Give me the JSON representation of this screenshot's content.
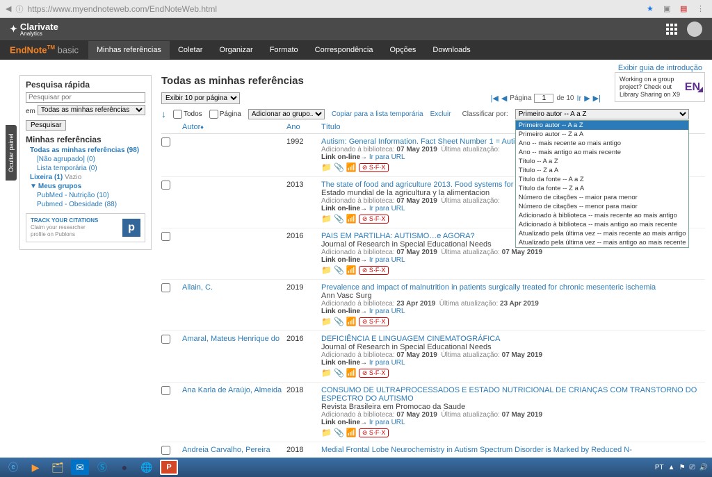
{
  "url": "https://www.myendnoteweb.com/EndNoteWeb.html",
  "clarivate": {
    "name": "Clarivate",
    "sub": "Analytics"
  },
  "brand": {
    "name": "EndNote",
    "tm": "TM",
    "variant": "basic"
  },
  "nav": {
    "items": [
      "Minhas referências",
      "Coletar",
      "Organizar",
      "Formato",
      "Correspondência",
      "Opções",
      "Downloads"
    ],
    "active": 0
  },
  "intro_link": "Exibir guia de introdução",
  "hide_panel": "Ocultar painel",
  "sidebar": {
    "quick_search": {
      "title": "Pesquisa rápida",
      "placeholder": "Pesquisar por",
      "in_label": "em",
      "scope": "Todas as minhas referências",
      "button": "Pesquisar"
    },
    "refs_title": "Minhas referências",
    "all_refs": "Todas as minhas referências (98)",
    "unfiled": "[Não agrupado] (0)",
    "temp": "Lista temporária (0)",
    "trash_label": "Lixeira (1)",
    "trash_empty": "Vazio",
    "groups_title": "Meus grupos",
    "groups": [
      "PubMed - Nutrição  (10)",
      "Pubmed - Obesidade  (88)"
    ],
    "track": {
      "title": "TRACK YOUR CITATIONS",
      "line1": "Claim your researcher",
      "line2": "profile on Publons"
    }
  },
  "content": {
    "title": "Todas as minhas referências",
    "per_page": "Exibir 10 por página",
    "pager": {
      "label": "Página",
      "current": "1",
      "of": "de 10",
      "go": "Ir"
    },
    "promo": "Working on a group project? Check out Library Sharing on X9",
    "promo_badge": "EN",
    "actions": {
      "all": "Todos",
      "page": "Página",
      "add_group": "Adicionar ao grupo...",
      "copy_temp": "Copiar para a lista temporária",
      "delete": "Excluir",
      "sort_label": "Classificar por:",
      "sort_selected": "Primeiro autor -- A a Z"
    },
    "sort_options": [
      "Primeiro autor -- A a Z",
      "Primeiro autor -- Z a A",
      "Ano -- mais recente ao mais antigo",
      "Ano -- mais antigo ao mais recente",
      "Título -- A a Z",
      "Título -- Z a A",
      "Título da fonte -- A a Z",
      "Título da fonte -- Z a A",
      "Número de citações -- maior para menor",
      "Número de citações -- menor para maior",
      "Adicionado à biblioteca -- mais recente ao mais antigo",
      "Adicionado à biblioteca -- mais antigo ao mais recente",
      "Atualizado pela última vez -- mais recente ao mais antigo",
      "Atualizado pela última vez -- mais antigo ao mais recente"
    ],
    "columns": {
      "author": "Autor",
      "year": "Ano",
      "title": "Título"
    },
    "meta_labels": {
      "added": "Adicionado à biblioteca:",
      "updated": "Última atualização:",
      "link": "Link on-line",
      "go_url": "Ir para URL",
      "sfx": "S·F·X"
    },
    "rows": [
      {
        "author": "",
        "year": "1992",
        "title": "Autism: General Information. Fact Sheet Number 1 = Autismo: Informacion General. Numero 22",
        "journal": "",
        "added": "07 May 2019",
        "updated": ""
      },
      {
        "author": "",
        "year": "2013",
        "title": "The state of food and agriculture 2013. Food systems for better nutrition",
        "journal": "Estado mundial de la agricultura y la alimentacion",
        "added": "07 May 2019",
        "updated": ""
      },
      {
        "author": "",
        "year": "2016",
        "title": "PAIS EM PARTILHA: AUTISMO…e AGORA?",
        "journal": "Journal of Research in Special Educational Needs",
        "added": "07 May 2019",
        "updated": "07 May 2019"
      },
      {
        "author": "Allain, C.",
        "year": "2019",
        "title": "Prevalence and impact of malnutrition in patients surgically treated for chronic mesenteric ischemia",
        "journal": "Ann Vasc Surg",
        "added": "23 Apr 2019",
        "updated": "23 Apr 2019"
      },
      {
        "author": "Amaral, Mateus Henrique do",
        "year": "2016",
        "title": "DEFICIÊNCIA E LINGUAGEM CINEMATOGRÁFICA",
        "journal": "Journal of Research in Special Educational Needs",
        "added": "07 May 2019",
        "updated": "07 May 2019"
      },
      {
        "author": "Ana Karla de Araújo, Almeida",
        "year": "2018",
        "title": "CONSUMO DE ULTRAPROCESSADOS E ESTADO NUTRICIONAL DE CRIANÇAS COM TRANSTORNO DO ESPECTRO DO AUTISMO",
        "journal": "Revista Brasileira em Promocao da Saude",
        "added": "07 May 2019",
        "updated": "07 May 2019"
      },
      {
        "author": "Andreia Carvalho, Pereira",
        "year": "2018",
        "title": "Medial Frontal Lobe Neurochemistry in Autism Spectrum Disorder is Marked by Reduced N-",
        "journal": "",
        "added": "",
        "updated": ""
      }
    ]
  },
  "taskbar": {
    "lang": "PT"
  }
}
